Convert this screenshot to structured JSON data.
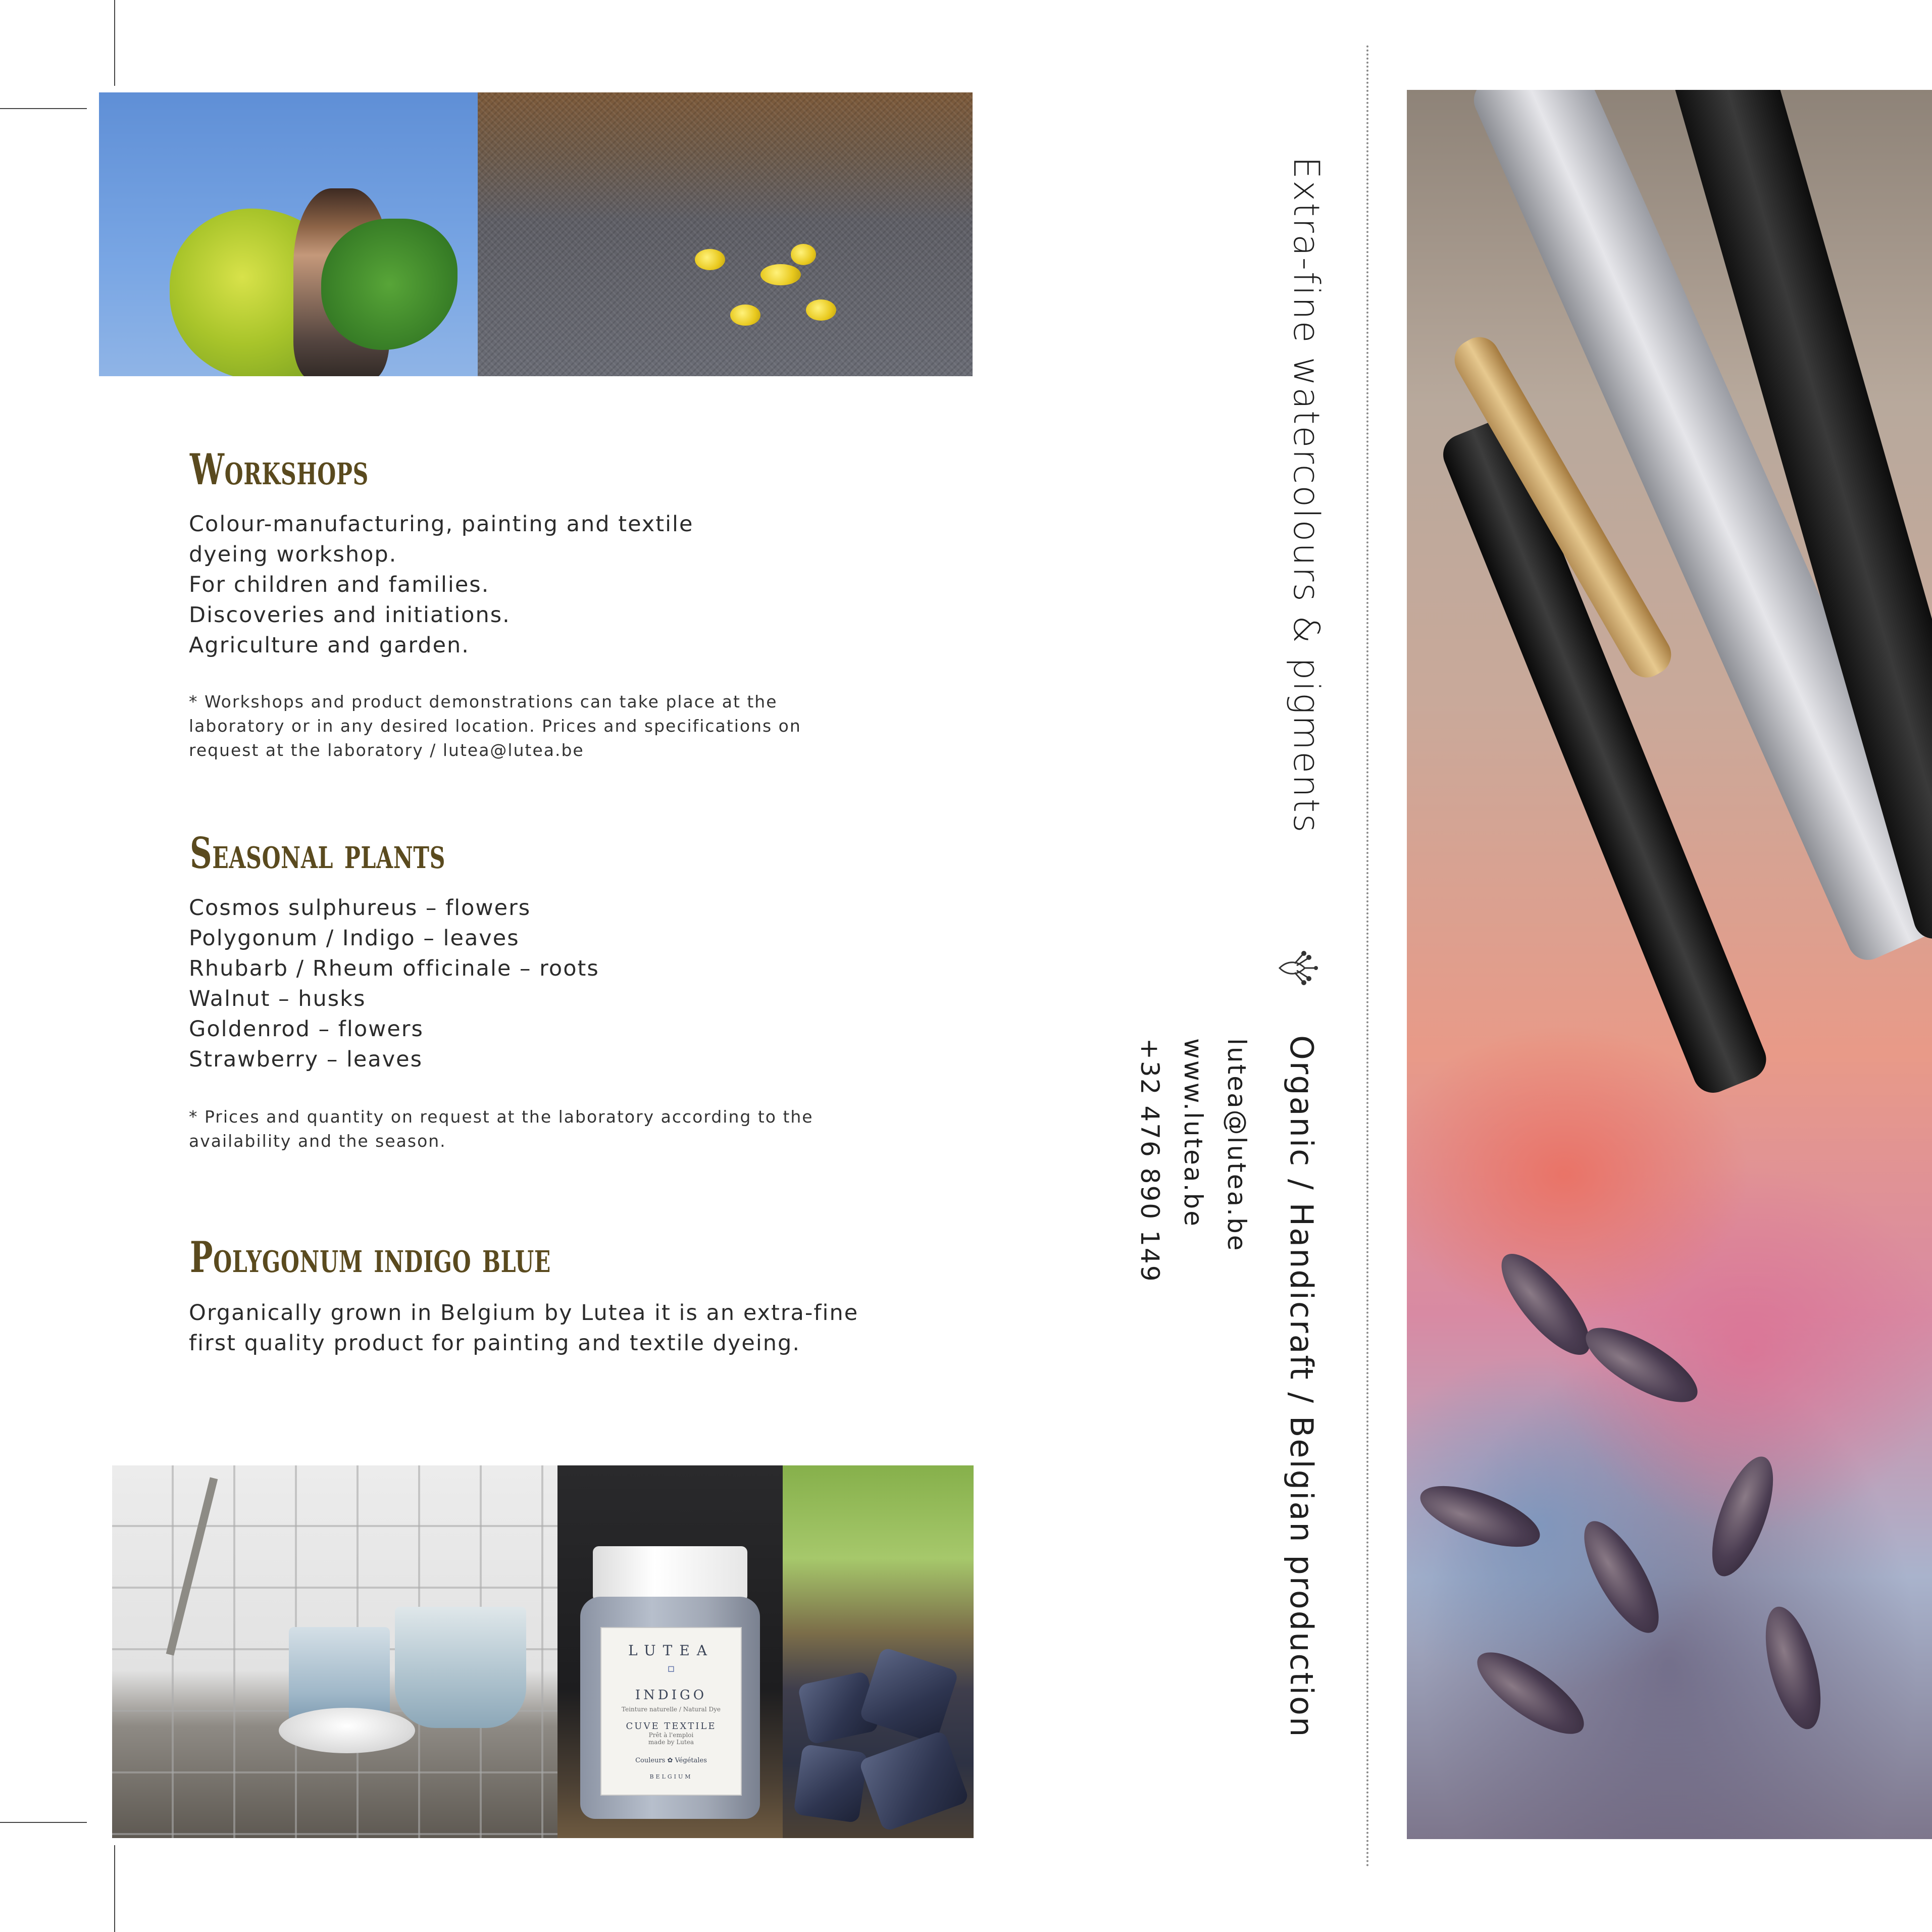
{
  "sections": {
    "workshops": {
      "title": "Workshops",
      "lines": [
        "Colour-manufacturing, painting and textile",
        "dyeing workshop.",
        "For children and families.",
        "Discoveries and initiations.",
        "Agriculture and garden."
      ],
      "note": "* Workshops and product demonstrations can take place at the laboratory or in any desired location. Prices and specifications on request at the laboratory / lutea@lutea.be"
    },
    "seasonal": {
      "title": "Seasonal plants",
      "lines": [
        "Cosmos sulphureus – flowers",
        "Polygonum / Indigo – leaves",
        "Rhubarb / Rheum officinale – roots",
        "Walnut – husks",
        "Goldenrod – flowers",
        "Strawberry – leaves"
      ],
      "note": "* Prices and quantity on request at the laboratory according to the availability and the season."
    },
    "indigo": {
      "title": "Polygonum indigo blue",
      "lines": [
        "Organically grown in Belgium by Lutea it is an extra-fine",
        "first quality product for painting and textile dyeing."
      ]
    }
  },
  "side": {
    "tagline": "Extra-fine watercolours & pigments",
    "values": "Organic  /  Handicraft  /  Belgian production",
    "contact": {
      "email": "lutea@lutea.be",
      "web": "www.lutea.be",
      "phone": "+32 476 890 149"
    },
    "icon": "flower-icon"
  },
  "jar_label": {
    "brand": "LUTEA",
    "product": "INDIGO",
    "subtitle": "Teinture naturelle / Natural Dye",
    "type": "CUVE TEXTILE",
    "detail": "Prêt à l'emploi",
    "made": "made by Lutea",
    "badge": "Couleurs ✿ Végétales",
    "country": "BELGIUM"
  },
  "colors": {
    "heading": "#5a4a1e",
    "text": "#2b2b2b"
  }
}
